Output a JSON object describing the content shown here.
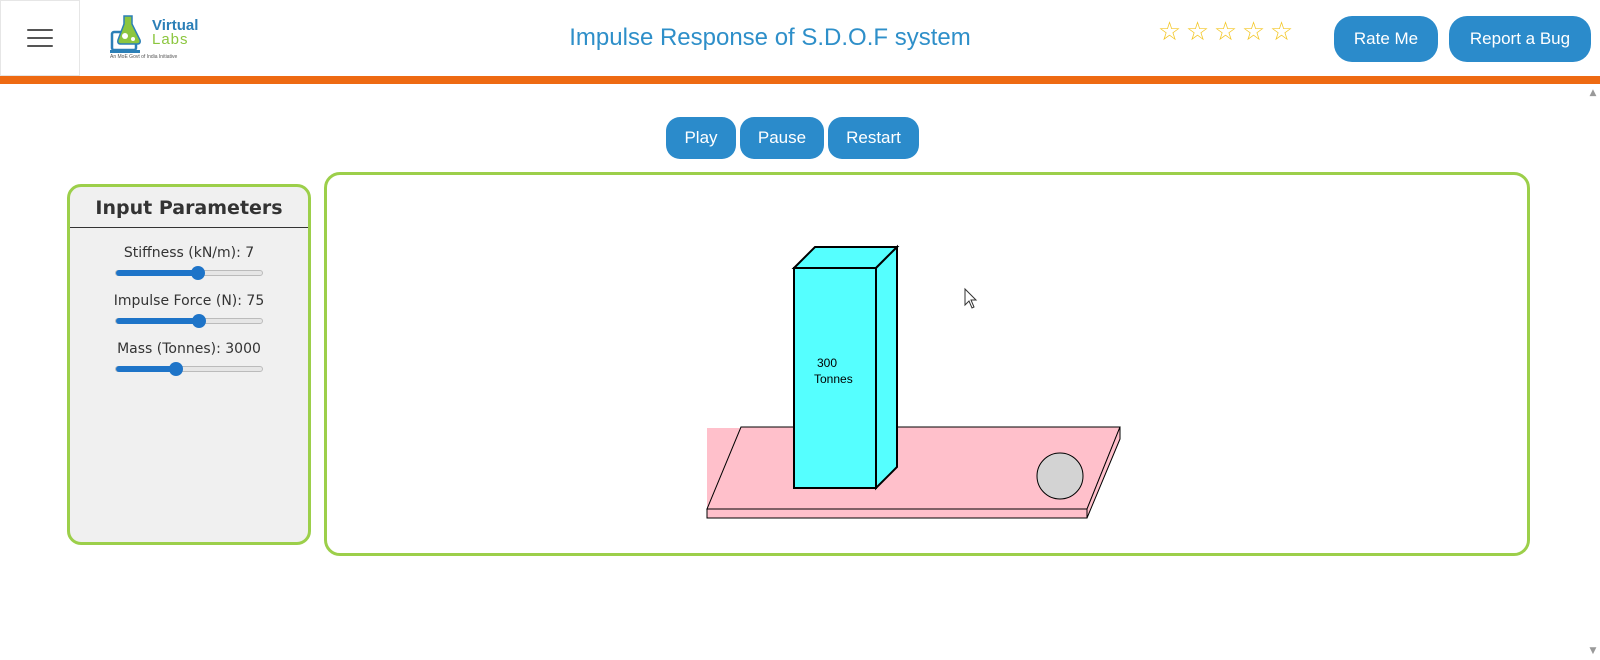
{
  "header": {
    "title": "Impulse Response of S.D.O.F system",
    "logo": {
      "line1": "Virtual",
      "line2": "Labs",
      "tagline": "An MoE Govt of India Initiative"
    },
    "rating": {
      "stars": 5,
      "filled": 0,
      "icon": "star-outline-icon"
    },
    "rate_label": "Rate Me",
    "bug_label": "Report a Bug"
  },
  "controls": {
    "play": "Play",
    "pause": "Pause",
    "restart": "Restart"
  },
  "panel": {
    "title": "Input Parameters",
    "params": [
      {
        "label": "Stiffness (kN/m): 7",
        "fraction": 0.56
      },
      {
        "label": "Impulse Force (N): 75",
        "fraction": 0.57
      },
      {
        "label": "Mass (Tonnes): 3000",
        "fraction": 0.41
      }
    ]
  },
  "simulation": {
    "mass_value": "300",
    "mass_unit": "Tonnes"
  },
  "colors": {
    "accent": "#2b8bcb",
    "orange": "#ee6a12",
    "border_green": "#9ccf4a",
    "block": "#55ffff",
    "platform": "#ffc0cb",
    "slider": "#1e74c8"
  }
}
